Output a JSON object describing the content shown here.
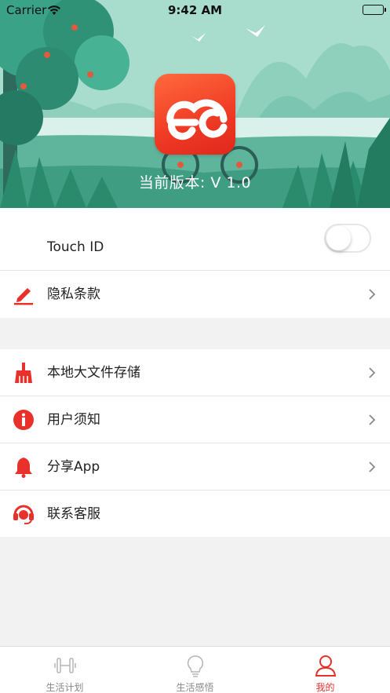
{
  "status_bar": {
    "carrier": "Carrier",
    "time": "9:42 AM"
  },
  "header": {
    "version_text": "当前版本: V 1.0",
    "logo_icon": "ec-cloud-logo-icon"
  },
  "settings": {
    "touch_id": {
      "label": "Touch ID",
      "enabled": false
    },
    "privacy": {
      "label": "隐私条款",
      "icon": "pencil-icon"
    }
  },
  "menu": {
    "items": [
      {
        "label": "本地大文件存储",
        "icon": "broom-icon"
      },
      {
        "label": "用户须知",
        "icon": "info-icon"
      },
      {
        "label": "分享App",
        "icon": "bell-icon"
      },
      {
        "label": "联系客服",
        "icon": "headset-icon"
      }
    ]
  },
  "tabbar": {
    "tabs": [
      {
        "label": "生活计划",
        "icon": "dumbbell-icon",
        "active": false
      },
      {
        "label": "生活感悟",
        "icon": "lightbulb-icon",
        "active": false
      },
      {
        "label": "我的",
        "icon": "person-icon",
        "active": true
      }
    ]
  },
  "colors": {
    "accent": "#e8312a",
    "header_bg": "#9fd8c8",
    "background": "#f2f2f2"
  }
}
